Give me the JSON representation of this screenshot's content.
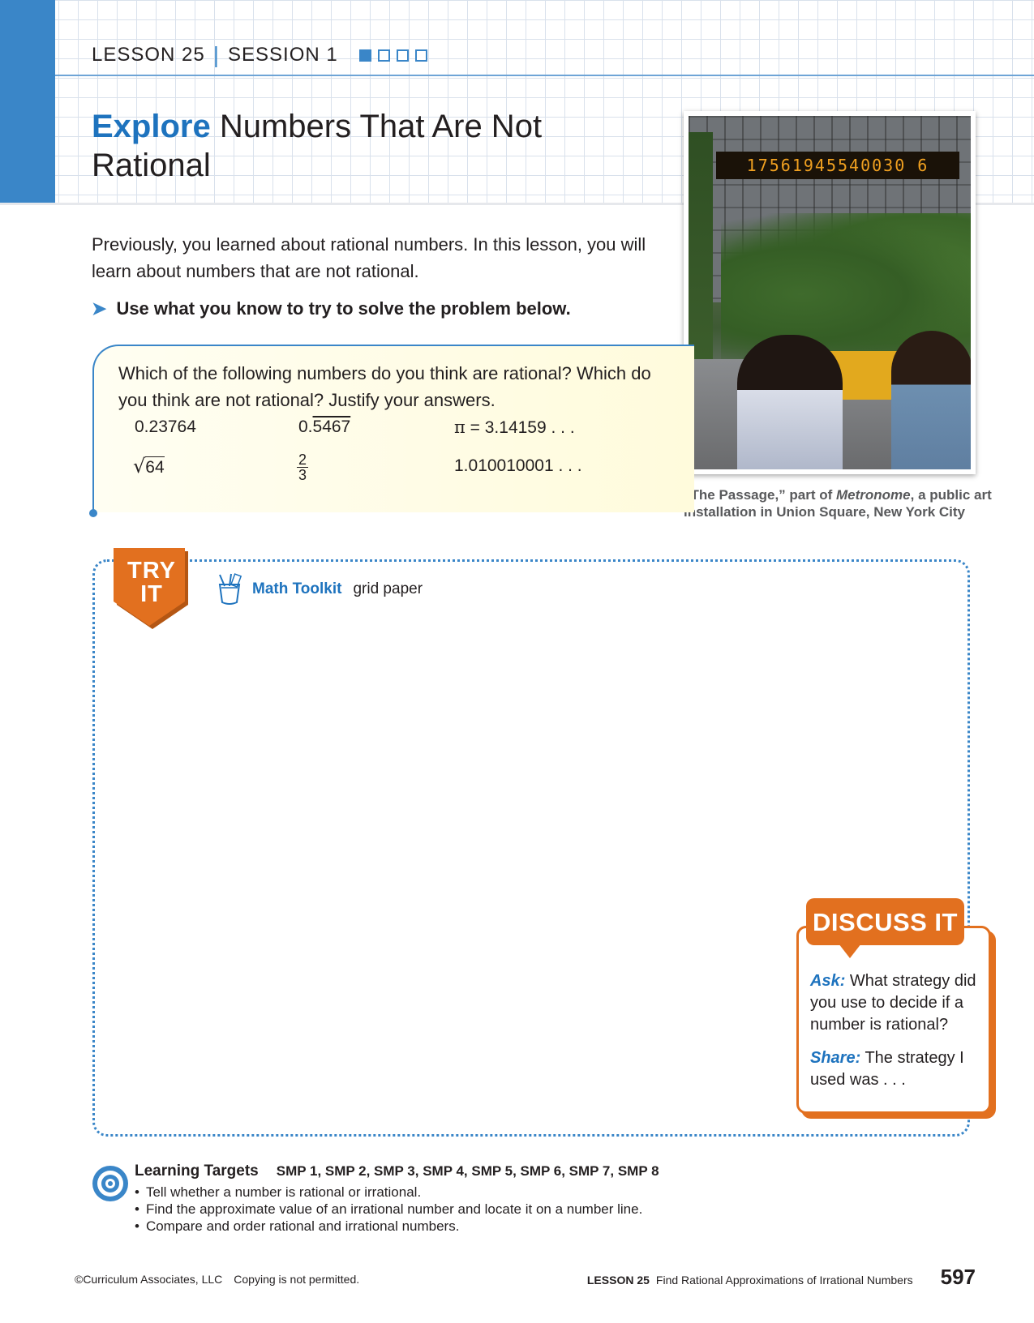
{
  "header": {
    "lesson": "LESSON 25",
    "session": "SESSION 1",
    "session_progress": {
      "current": 1,
      "total": 4
    }
  },
  "title": {
    "highlight": "Explore",
    "rest": "Numbers That Are Not Rational"
  },
  "photo": {
    "display_digits": "17561945540030 6",
    "caption_part1": "“The Passage,” part of ",
    "caption_italic": "Metronome",
    "caption_part2": ", a public art installation in Union Square, New York City"
  },
  "intro": "Previously, you learned about rational numbers. In this lesson, you will learn about numbers that are not rational.",
  "directive": "Use what you know to try to solve the problem below.",
  "problem": {
    "question": "Which of the following numbers do you think are rational? Which do you think are not rational? Justify your answers.",
    "numbers": {
      "n1": "0.23764",
      "n2_whole": "0.",
      "n2_repeat": "5467",
      "n3_symbol": "π",
      "n3_rest": " = 3.14159 . . .",
      "n4_radicand": "64",
      "n5_numerator": "2",
      "n5_denominator": "3",
      "n6": "1.010010001 . . ."
    }
  },
  "try_it": {
    "badge_line1": "TRY",
    "badge_line2": "IT",
    "toolkit_label": "Math Toolkit",
    "toolkit_item": "grid paper"
  },
  "discuss": {
    "title": "DISCUSS IT",
    "ask_lead": "Ask:",
    "ask_text": " What strategy did you use to decide if a number is rational?",
    "share_lead": "Share:",
    "share_text": " The strategy I used was . . ."
  },
  "learning_targets": {
    "heading": "Learning Targets",
    "smp": "SMP 1, SMP 2, SMP 3, SMP 4, SMP 5, SMP 6, SMP 7, SMP 8",
    "items": [
      "Tell whether a number is rational or irrational.",
      "Find the approximate value of an irrational number and locate it on a number line.",
      "Compare and order rational and irrational numbers."
    ]
  },
  "footer": {
    "copyright": "©Curriculum Associates, LLC",
    "notice": "Copying is not permitted.",
    "lesson_tag": "LESSON 25",
    "lesson_title": "Find Rational Approximations of Irrational Numbers",
    "page_number": "597"
  },
  "colors": {
    "accent_blue": "#3a86c8",
    "title_blue": "#1e73be",
    "orange": "#e2701f"
  }
}
